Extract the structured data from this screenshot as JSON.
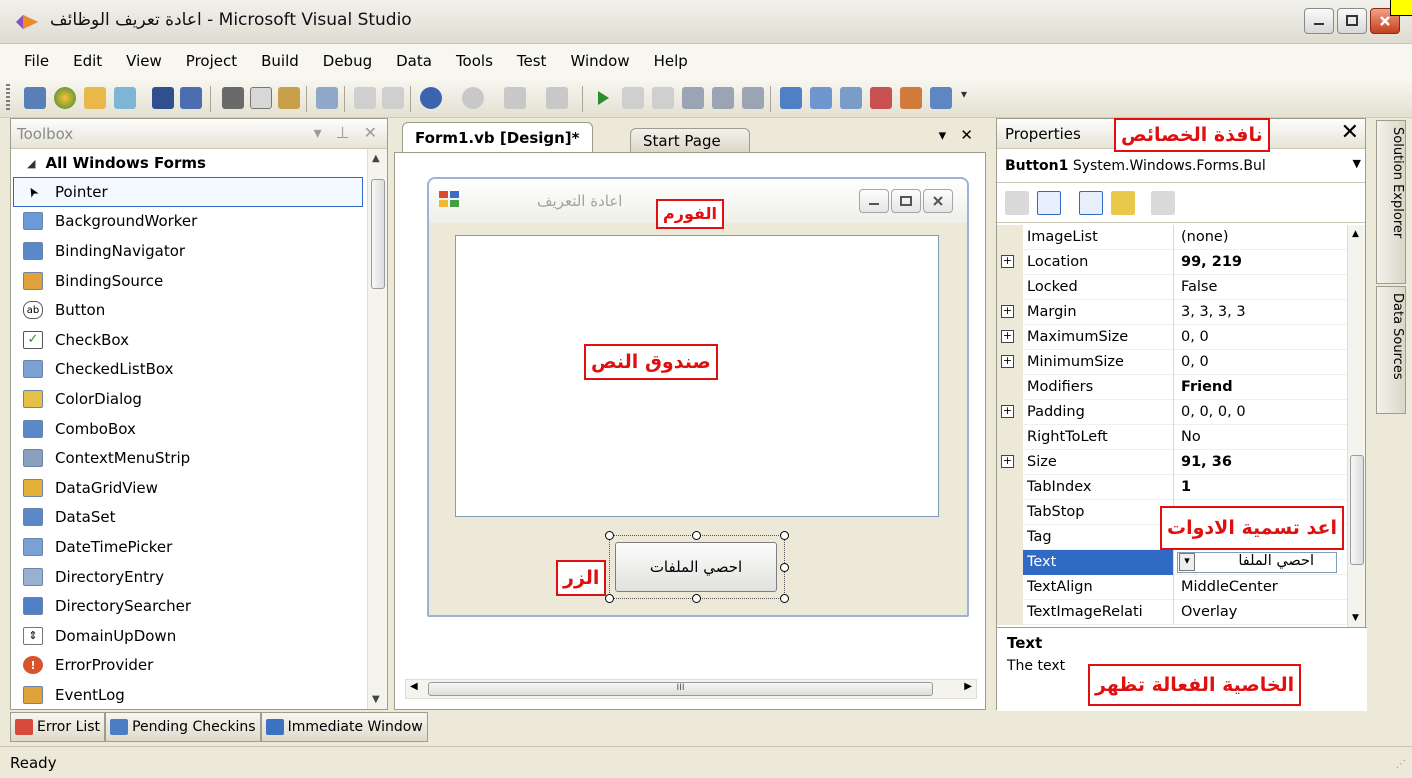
{
  "window": {
    "title": "اعادة تعريف الوظائف - Microsoft Visual Studio"
  },
  "menu": [
    "File",
    "Edit",
    "View",
    "Project",
    "Build",
    "Debug",
    "Data",
    "Tools",
    "Test",
    "Window",
    "Help"
  ],
  "toolbox": {
    "title": "Toolbox",
    "group": "All Windows Forms",
    "items": [
      {
        "label": "Pointer",
        "icon": "pointer-icon"
      },
      {
        "label": "BackgroundWorker",
        "icon": "background-worker-icon"
      },
      {
        "label": "BindingNavigator",
        "icon": "binding-navigator-icon"
      },
      {
        "label": "BindingSource",
        "icon": "binding-source-icon"
      },
      {
        "label": "Button",
        "icon": "button-icon"
      },
      {
        "label": "CheckBox",
        "icon": "checkbox-icon"
      },
      {
        "label": "CheckedListBox",
        "icon": "checked-listbox-icon"
      },
      {
        "label": "ColorDialog",
        "icon": "color-dialog-icon"
      },
      {
        "label": "ComboBox",
        "icon": "combobox-icon"
      },
      {
        "label": "ContextMenuStrip",
        "icon": "context-menu-icon"
      },
      {
        "label": "DataGridView",
        "icon": "datagrid-icon"
      },
      {
        "label": "DataSet",
        "icon": "dataset-icon"
      },
      {
        "label": "DateTimePicker",
        "icon": "datetime-icon"
      },
      {
        "label": "DirectoryEntry",
        "icon": "directory-entry-icon"
      },
      {
        "label": "DirectorySearcher",
        "icon": "directory-searcher-icon"
      },
      {
        "label": "DomainUpDown",
        "icon": "domain-updown-icon"
      },
      {
        "label": "ErrorProvider",
        "icon": "error-provider-icon"
      },
      {
        "label": "EventLog",
        "icon": "eventlog-icon"
      }
    ]
  },
  "document": {
    "tab_active": "Form1.vb [Design]*",
    "tab_inactive": "Start Page",
    "form_title": "اعادة التعريف",
    "button_text": "احصي الملفات",
    "scroll_mark": "III"
  },
  "properties": {
    "title": "Properties",
    "object_name": "Button1",
    "object_type": "System.Windows.Forms.Bul",
    "rows": [
      {
        "name": "ImageList",
        "value": "(none)",
        "expand": false,
        "bold": false
      },
      {
        "name": "Location",
        "value": "99, 219",
        "expand": true,
        "bold": true
      },
      {
        "name": "Locked",
        "value": "False",
        "expand": false,
        "bold": false
      },
      {
        "name": "Margin",
        "value": "3, 3, 3, 3",
        "expand": true,
        "bold": false
      },
      {
        "name": "MaximumSize",
        "value": "0, 0",
        "expand": true,
        "bold": false
      },
      {
        "name": "MinimumSize",
        "value": "0, 0",
        "expand": true,
        "bold": false
      },
      {
        "name": "Modifiers",
        "value": "Friend",
        "expand": false,
        "bold": true
      },
      {
        "name": "Padding",
        "value": "0, 0, 0, 0",
        "expand": true,
        "bold": false
      },
      {
        "name": "RightToLeft",
        "value": "No",
        "expand": false,
        "bold": false
      },
      {
        "name": "Size",
        "value": "91, 36",
        "expand": true,
        "bold": true
      },
      {
        "name": "TabIndex",
        "value": "1",
        "expand": false,
        "bold": true
      },
      {
        "name": "TabStop",
        "value": "",
        "expand": false,
        "bold": false
      },
      {
        "name": "Tag",
        "value": "",
        "expand": false,
        "bold": false
      },
      {
        "name": "Text",
        "value": "احصي الملفا",
        "expand": false,
        "bold": false,
        "selected": true
      },
      {
        "name": "TextAlign",
        "value": "MiddleCenter",
        "expand": false,
        "bold": false
      },
      {
        "name": "TextImageRelati",
        "value": "Overlay",
        "expand": false,
        "bold": false
      }
    ],
    "desc_title": "Text",
    "desc_text": "The text"
  },
  "side_tabs": [
    "Solution Explorer",
    "Data Sources"
  ],
  "bottom_tabs": [
    "Error List",
    "Pending Checkins",
    "Immediate Window"
  ],
  "status": "Ready",
  "annotations": {
    "properties_window": "نافذة الخصائص",
    "form": "الفورم",
    "textbox": "صندوق النص",
    "button": "الزر",
    "rename_tools": "اعد تسمية الادوات",
    "active_property": "الخاصية الفعالة تظهر"
  },
  "colors": {
    "selection": "#316ac5",
    "annotation_red": "#e01010",
    "chrome": "#ece9d8"
  }
}
